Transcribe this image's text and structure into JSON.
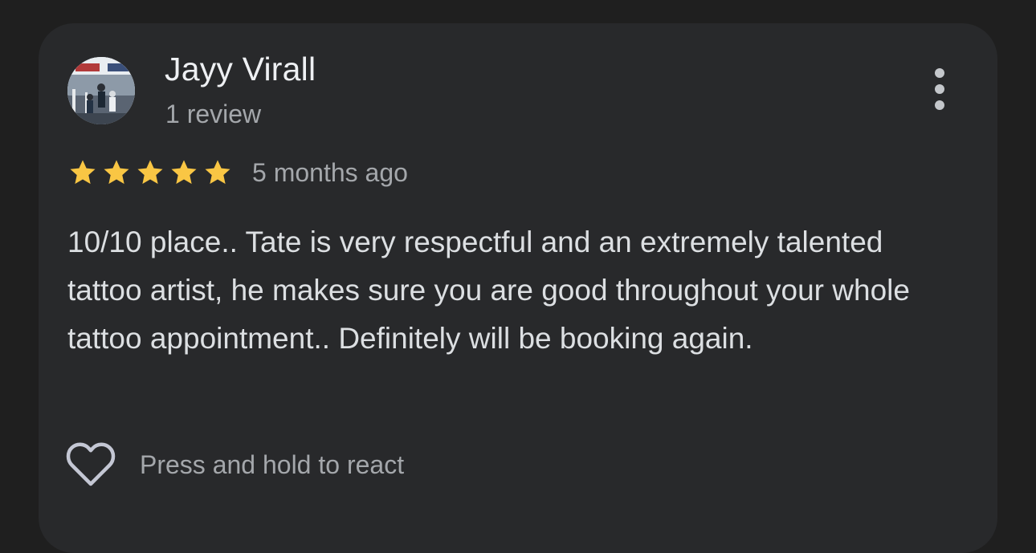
{
  "review": {
    "author": {
      "name": "Jayy Virall",
      "review_count": "1 review",
      "avatar_icon": "basketball-photo-avatar"
    },
    "rating": {
      "stars": 5,
      "max": 5,
      "star_color": "#f9c644",
      "time_ago": "5 months ago"
    },
    "text": "10/10 place.. Tate is very respectful and an extremely talented tattoo artist, he makes sure you are good throughout your whole tattoo appointment.. Definitely will be booking again.",
    "react": {
      "label": "Press and hold to react",
      "icon": "heart-outline-icon"
    },
    "menu_icon": "more-vert-icon"
  },
  "colors": {
    "background": "#1f1f1f",
    "card": "#28292b",
    "primary_text": "#eef0f3",
    "secondary_text": "#a4a7ab"
  }
}
